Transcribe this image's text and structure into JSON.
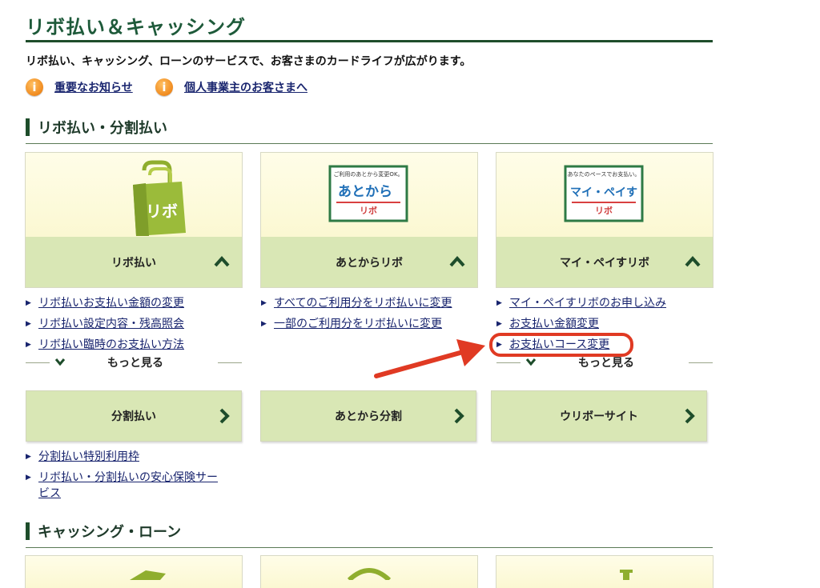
{
  "header": {
    "title": "リボ払い＆キャッシング",
    "intro": "リボ払い、キャッシング、ローンのサービスで、お客さまのカードライフが広がります。"
  },
  "notices": [
    {
      "icon": "info-icon",
      "label": "重要なお知らせ"
    },
    {
      "icon": "info-icon",
      "label": "個人事業主のお客さまへ"
    }
  ],
  "sections": {
    "revo": {
      "title": "リボ払い・分割払い"
    },
    "cashing": {
      "title": "キャッシング・ローン"
    }
  },
  "cards": [
    {
      "label": "リボ払い",
      "image_text": "リボ",
      "links": [
        "リボ払いお支払い金額の変更",
        "リボ払い設定内容・残高照会",
        "リボ払い臨時のお支払い方法"
      ],
      "more": "もっと見る"
    },
    {
      "label": "あとからリボ",
      "image_top": "ご利用のあとから変更OK。",
      "image_main": "あとから",
      "image_sub": "リボ",
      "links": [
        "すべてのご利用分をリボ払いに変更",
        "一部のご利用分をリボ払いに変更"
      ]
    },
    {
      "label": "マイ・ペイすリボ",
      "image_top": "あなたのペースでお支払い。",
      "image_main": "マイ・ペイす",
      "image_sub": "リボ",
      "links": [
        "マイ・ペイすリボのお申し込み",
        "お支払い金額変更",
        "お支払いコース変更"
      ],
      "more": "もっと見る"
    }
  ],
  "buttons": [
    {
      "label": "分割払い",
      "links": [
        "分割払い特別利用枠",
        "リボ払い・分割払いの安心保険サー",
        "ビス"
      ]
    },
    {
      "label": "あとから分割"
    },
    {
      "label": "ウリボーサイト"
    }
  ],
  "colors": {
    "title_green": "#1e5a3a",
    "card_label_bg": "#d9e7b5",
    "link": "#18246e",
    "highlight": "#e03a23"
  }
}
